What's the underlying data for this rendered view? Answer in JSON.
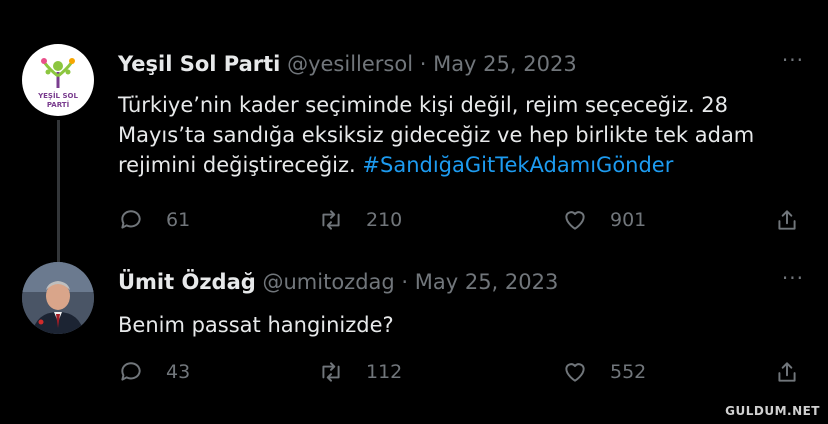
{
  "tweets": [
    {
      "display_name": "Yeşil Sol Parti",
      "handle_date": "@yesillersol · May 25, 2023",
      "text_plain": "Türkiye’nin kader seçiminde kişi değil, rejim seçeceğiz. 28 Mayıs’ta sandığa eksiksiz gideceğiz ve hep birlikte tek adam rejimini değiştireceğiz. ",
      "hashtag": "#SandığaGitTekAdamıGönder",
      "replies": "61",
      "retweets": "210",
      "likes": "901",
      "avatar_logo_text": [
        "YEŞİL SOL",
        "PARTİ"
      ]
    },
    {
      "display_name": "Ümit Özdağ",
      "handle_date": "@umitozdag · May 25, 2023",
      "text_plain": "Benim passat hanginizde?",
      "replies": "43",
      "retweets": "112",
      "likes": "552"
    }
  ],
  "more_label": "···",
  "watermark": "GULDUM.NET",
  "colors": {
    "background": "#000000",
    "text": "#e7e9ea",
    "muted": "#71767b",
    "link": "#1d9bf0"
  }
}
